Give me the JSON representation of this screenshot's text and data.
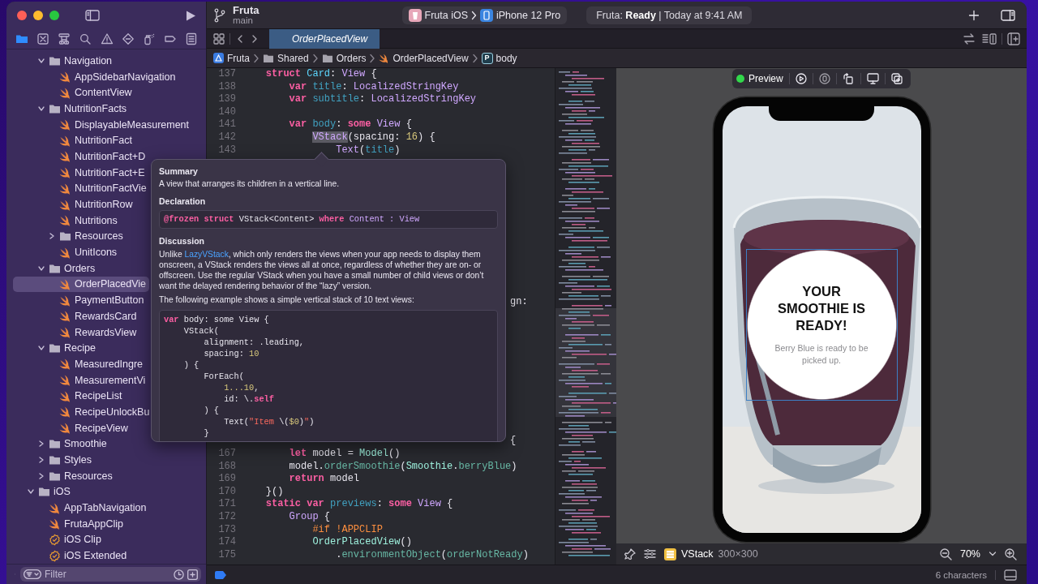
{
  "toolbar": {
    "project": "Fruta",
    "branch": "main",
    "scheme": "Fruta iOS",
    "device": "iPhone 12 Pro",
    "status": "Fruta: **Ready** | Today at 9:41 AM"
  },
  "navigator_tabs": [
    {
      "kind": "files",
      "selected": true
    },
    {
      "kind": "source-control",
      "selected": false
    },
    {
      "kind": "hierarchy",
      "selected": false
    },
    {
      "kind": "search",
      "selected": false
    },
    {
      "kind": "issues",
      "selected": false
    },
    {
      "kind": "tests",
      "selected": false
    },
    {
      "kind": "debug",
      "selected": false
    },
    {
      "kind": "breakpoints",
      "selected": false
    },
    {
      "kind": "reports",
      "selected": false
    }
  ],
  "tree": [
    {
      "kind": "group",
      "children": [
        {
          "kind": "folder",
          "label": "Navigation",
          "expanded": true,
          "selected": false,
          "children": [
            {
              "kind": "swift",
              "label": "AppSidebarNavigation",
              "selected": false
            },
            {
              "kind": "swift",
              "label": "ContentView",
              "selected": false
            }
          ]
        },
        {
          "kind": "folder",
          "label": "NutritionFacts",
          "expanded": true,
          "selected": false,
          "children": [
            {
              "kind": "swift",
              "label": "DisplayableMeasurement",
              "selected": false
            },
            {
              "kind": "swift",
              "label": "NutritionFact",
              "selected": false
            },
            {
              "kind": "swift",
              "label": "NutritionFact+D",
              "selected": false
            },
            {
              "kind": "swift",
              "label": "NutritionFact+E",
              "selected": false
            },
            {
              "kind": "swift",
              "label": "NutritionFactVie",
              "selected": false
            },
            {
              "kind": "swift",
              "label": "NutritionRow",
              "selected": false
            },
            {
              "kind": "swift",
              "label": "Nutritions",
              "selected": false
            },
            {
              "kind": "folder",
              "label": "Resources",
              "expanded": false,
              "selected": false
            },
            {
              "kind": "swift",
              "label": "UnitIcons",
              "selected": false
            }
          ]
        },
        {
          "kind": "folder",
          "label": "Orders",
          "expanded": true,
          "selected": false,
          "children": [
            {
              "kind": "swift",
              "label": "OrderPlacedVie",
              "selected": true
            },
            {
              "kind": "swift",
              "label": "PaymentButton",
              "selected": false
            },
            {
              "kind": "swift",
              "label": "RewardsCard",
              "selected": false
            },
            {
              "kind": "swift",
              "label": "RewardsView",
              "selected": false
            }
          ]
        },
        {
          "kind": "folder",
          "label": "Recipe",
          "expanded": true,
          "selected": false,
          "children": [
            {
              "kind": "swift",
              "label": "MeasuredIngre",
              "selected": false
            },
            {
              "kind": "swift",
              "label": "MeasurementVi",
              "selected": false
            },
            {
              "kind": "swift",
              "label": "RecipeList",
              "selected": false
            },
            {
              "kind": "swift",
              "label": "RecipeUnlockBu",
              "selected": false
            },
            {
              "kind": "swift",
              "label": "RecipeView",
              "selected": false
            }
          ]
        },
        {
          "kind": "folder",
          "label": "Smoothie",
          "expanded": false,
          "selected": false
        },
        {
          "kind": "folder",
          "label": "Styles",
          "expanded": false,
          "selected": false
        },
        {
          "kind": "folder",
          "label": "Resources",
          "expanded": false,
          "selected": false
        }
      ]
    },
    {
      "kind": "folder",
      "label": "iOS",
      "expanded": true,
      "selected": false,
      "children": [
        {
          "kind": "swift",
          "label": "AppTabNavigation",
          "selected": false
        },
        {
          "kind": "swift",
          "label": "FrutaAppClip",
          "selected": false
        },
        {
          "kind": "target",
          "label": "iOS Clip",
          "selected": false
        },
        {
          "kind": "target",
          "label": "iOS Extended",
          "selected": false
        }
      ]
    }
  ],
  "filter": {
    "placeholder": "Filter"
  },
  "editor_tabs": [
    {
      "label": "OrderPlacedView",
      "selected": true
    }
  ],
  "breadcrumb": [
    {
      "kind": "app",
      "label": "Fruta"
    },
    {
      "kind": "folder",
      "label": "Shared"
    },
    {
      "kind": "folder",
      "label": "Orders"
    },
    {
      "kind": "swift",
      "label": "OrderPlacedView"
    },
    {
      "kind": "property",
      "letter": "P",
      "label": "body"
    }
  ],
  "code_lines_top": [
    {
      "number": "137",
      "tokens": [
        {
          "kind": "keyword",
          "text": "    struct"
        },
        {
          "kind": "typedecl",
          "text": " Card"
        },
        {
          "kind": "plain",
          "text": ": "
        },
        {
          "kind": "type",
          "text": "View"
        },
        {
          "kind": "plain",
          "text": " {"
        }
      ]
    },
    {
      "number": "138",
      "tokens": [
        {
          "kind": "keyword",
          "text": "        var"
        },
        {
          "kind": "decl",
          "text": " title"
        },
        {
          "kind": "plain",
          "text": ": "
        },
        {
          "kind": "type",
          "text": "LocalizedStringKey"
        }
      ]
    },
    {
      "number": "139",
      "tokens": [
        {
          "kind": "keyword",
          "text": "        var"
        },
        {
          "kind": "decl",
          "text": " subtitle"
        },
        {
          "kind": "plain",
          "text": ": "
        },
        {
          "kind": "type",
          "text": "LocalizedStringKey"
        }
      ]
    },
    {
      "number": "140"
    },
    {
      "number": "141",
      "tokens": [
        {
          "kind": "keyword",
          "text": "        var"
        },
        {
          "kind": "decl",
          "text": " body"
        },
        {
          "kind": "plain",
          "text": ": "
        },
        {
          "kind": "keyword",
          "text": "some"
        },
        {
          "kind": "type",
          "text": " View"
        },
        {
          "kind": "plain",
          "text": " {"
        }
      ]
    },
    {
      "number": "142",
      "tokens": [
        {
          "kind": "highlight",
          "text": "            VStack"
        },
        {
          "kind": "plain",
          "text": "(spacing: "
        },
        {
          "kind": "number",
          "text": "16"
        },
        {
          "kind": "plain",
          "text": ") {"
        }
      ]
    },
    {
      "number": "143",
      "tokens": [
        {
          "kind": "type",
          "text": "                Text"
        },
        {
          "kind": "plain",
          "text": "("
        },
        {
          "kind": "decl",
          "text": "title"
        },
        {
          "kind": "plain",
          "text": ")"
        }
      ]
    }
  ],
  "code_fragments": [
    {
      "tokens": [
        {
          "kind": "plain",
          "text": "gn:"
        }
      ]
    },
    {
      "tokens": [
        {
          "kind": "plain",
          "text": "{"
        }
      ]
    }
  ],
  "code_lines_bottom": [
    {
      "number": "167",
      "tokens": [
        {
          "kind": "keyword",
          "text": "        let"
        },
        {
          "kind": "plain",
          "text": " model = "
        },
        {
          "kind": "projtype",
          "text": "Model"
        },
        {
          "kind": "plain",
          "text": "()"
        }
      ]
    },
    {
      "number": "168",
      "tokens": [
        {
          "kind": "plain",
          "text": "        model."
        },
        {
          "kind": "func",
          "text": "orderSmoothie"
        },
        {
          "kind": "plain",
          "text": "("
        },
        {
          "kind": "projtype",
          "text": "Smoothie"
        },
        {
          "kind": "plain",
          "text": "."
        },
        {
          "kind": "func",
          "text": "berryBlue"
        },
        {
          "kind": "plain",
          "text": ")"
        }
      ]
    },
    {
      "number": "169",
      "tokens": [
        {
          "kind": "keyword",
          "text": "        return"
        },
        {
          "kind": "plain",
          "text": " model"
        }
      ]
    },
    {
      "number": "170",
      "tokens": [
        {
          "kind": "plain",
          "text": "    }()"
        }
      ]
    },
    {
      "number": "171",
      "tokens": [
        {
          "kind": "keyword",
          "text": "    static var"
        },
        {
          "kind": "decl",
          "text": " previews"
        },
        {
          "kind": "plain",
          "text": ": "
        },
        {
          "kind": "keyword",
          "text": "some"
        },
        {
          "kind": "type",
          "text": " View"
        },
        {
          "kind": "plain",
          "text": " {"
        }
      ]
    },
    {
      "number": "172",
      "tokens": [
        {
          "kind": "type",
          "text": "        Group"
        },
        {
          "kind": "plain",
          "text": " {"
        }
      ]
    },
    {
      "number": "173",
      "tokens": [
        {
          "kind": "preproc",
          "text": "            #if !APPCLIP"
        }
      ]
    },
    {
      "number": "174",
      "tokens": [
        {
          "kind": "projtype",
          "text": "            OrderPlacedView"
        },
        {
          "kind": "plain",
          "text": "()"
        }
      ]
    },
    {
      "number": "175",
      "tokens": [
        {
          "kind": "plain",
          "text": "                ."
        },
        {
          "kind": "func",
          "text": "environmentObject"
        },
        {
          "kind": "plain",
          "text": "("
        },
        {
          "kind": "func",
          "text": "orderNotReady"
        },
        {
          "kind": "plain",
          "text": ")"
        }
      ]
    }
  ],
  "quick_help": {
    "summary_heading": "Summary",
    "summary": "A view that arranges its children in a vertical line.",
    "declaration_heading": "Declaration",
    "declaration": [
      {
        "kind": "keyword",
        "text": "@frozen"
      },
      {
        "kind": "keyword",
        "text": " struct"
      },
      {
        "kind": "plain",
        "text": " VStack<Content> "
      },
      {
        "kind": "keyword",
        "text": "where"
      },
      {
        "kind": "type",
        "text": " Content : View"
      }
    ],
    "discussion_heading": "Discussion",
    "discussion": [
      {
        "kind": "text",
        "text": "Unlike "
      },
      {
        "kind": "link",
        "text": "LazyVStack"
      },
      {
        "kind": "text",
        "text": ", which only renders the views when your app needs to display them onscreen, a VStack renders the views all at once, regardless of whether they are on- or offscreen. Use the regular VStack when you have a small number of child views or don’t want the delayed rendering behavior of the “lazy” version."
      }
    ],
    "example_intro": "The following example shows a simple vertical stack of 10 text views:",
    "example": [
      [
        {
          "kind": "keyword",
          "text": "var"
        },
        {
          "kind": "plain",
          "text": " body: some View {"
        }
      ],
      [
        {
          "kind": "plain",
          "text": "    VStack("
        }
      ],
      [
        {
          "kind": "plain",
          "text": "        alignment: .leading,"
        }
      ],
      [
        {
          "kind": "plain",
          "text": "        spacing: "
        },
        {
          "kind": "number",
          "text": "10"
        }
      ],
      [
        {
          "kind": "plain",
          "text": "    ) {"
        }
      ],
      [
        {
          "kind": "plain",
          "text": "        ForEach("
        }
      ],
      [
        {
          "kind": "number",
          "text": "            1...10"
        },
        {
          "kind": "plain",
          "text": ","
        }
      ],
      [
        {
          "kind": "plain",
          "text": "            id: \\."
        },
        {
          "kind": "keyword",
          "text": "self"
        }
      ],
      [
        {
          "kind": "plain",
          "text": "        ) {"
        }
      ],
      [
        {
          "kind": "plain",
          "text": "            Text("
        },
        {
          "kind": "string",
          "text": "\"Item "
        },
        {
          "kind": "plain",
          "text": "\\("
        },
        {
          "kind": "number",
          "text": "$0"
        },
        {
          "kind": "plain",
          "text": ")"
        },
        {
          "kind": "string",
          "text": "\""
        },
        {
          "kind": "plain",
          "text": ")"
        }
      ],
      [
        {
          "kind": "plain",
          "text": "        }"
        }
      ]
    ]
  },
  "preview": {
    "label": "Preview",
    "card_title": "YOUR SMOOTHIE IS READY!",
    "card_subtitle": "Berry Blue is ready to be picked up.",
    "selection": "VStack",
    "size": "300×300",
    "zoom": "70%"
  },
  "status_bar": {
    "text": "6 characters"
  }
}
